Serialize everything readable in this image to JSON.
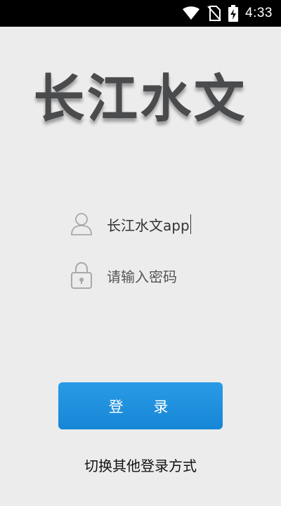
{
  "status_bar": {
    "time": "4:33",
    "icons": [
      "wifi-icon",
      "no-sim-icon",
      "battery-charging-icon"
    ]
  },
  "app": {
    "logo_text": "长江水文"
  },
  "login_form": {
    "username_value": "长江水文app",
    "password_placeholder": "请输入密码",
    "login_label": "登 录",
    "switch_method_label": "切换其他登录方式"
  },
  "colors": {
    "background": "#ececec",
    "button": "#1a8ee0",
    "logo": "#4a4b4d"
  }
}
